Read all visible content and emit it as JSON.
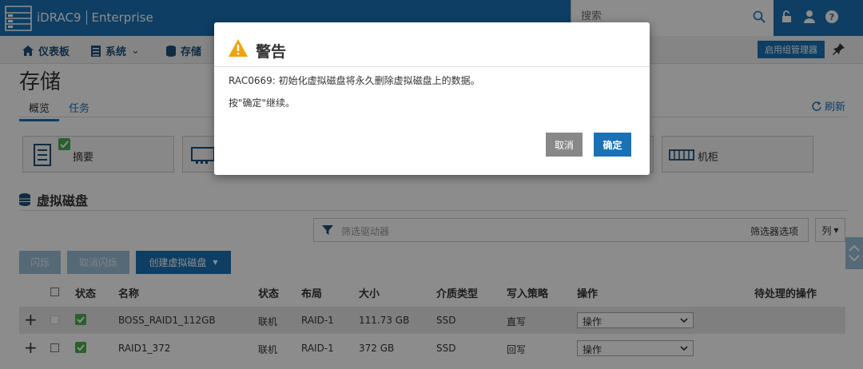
{
  "header": {
    "product": "iDRAC9",
    "edition": "Enterprise",
    "search_placeholder": "搜索"
  },
  "nav": {
    "items": [
      {
        "label": "仪表板"
      },
      {
        "label": "系统"
      },
      {
        "label": "存储"
      }
    ],
    "group_manager_button": "启用组管理器"
  },
  "page": {
    "title": "存储",
    "tabs": [
      {
        "label": "概览"
      },
      {
        "label": "任务"
      }
    ],
    "refresh": "刷新"
  },
  "cards": [
    {
      "label": "摘要"
    },
    {
      "label": ""
    },
    {
      "label": "机柜"
    }
  ],
  "section": {
    "title": "虚拟磁盘"
  },
  "filter": {
    "placeholder": "筛选驱动器",
    "options_label": "筛选器选项",
    "columns_label": "列"
  },
  "toolbar": {
    "blink": "闪烁",
    "unblink": "取消闪烁",
    "create": "创建虚拟磁盘"
  },
  "table": {
    "headers": [
      "状态",
      "名称",
      "状态",
      "布局",
      "大小",
      "介质类型",
      "写入策略",
      "操作",
      "待处理的操作"
    ],
    "rows": [
      {
        "name": "BOSS_RAID1_112GB",
        "state": "联机",
        "layout": "RAID-1",
        "size": "111.73 GB",
        "media": "SSD",
        "write_policy": "直写",
        "action": "操作"
      },
      {
        "name": "RAID1_372",
        "state": "联机",
        "layout": "RAID-1",
        "size": "372 GB",
        "media": "SSD",
        "write_policy": "回写",
        "action": "操作"
      }
    ]
  },
  "modal": {
    "title": "警告",
    "message": "RAC0669: 初始化虚拟磁盘将永久删除虚拟磁盘上的数据。",
    "instruction": "按\"确定\"继续。",
    "cancel": "取消",
    "ok": "确定"
  },
  "colors": {
    "brand": "#1a72b5",
    "warning": "#f0a30a",
    "success": "#4caf50"
  }
}
